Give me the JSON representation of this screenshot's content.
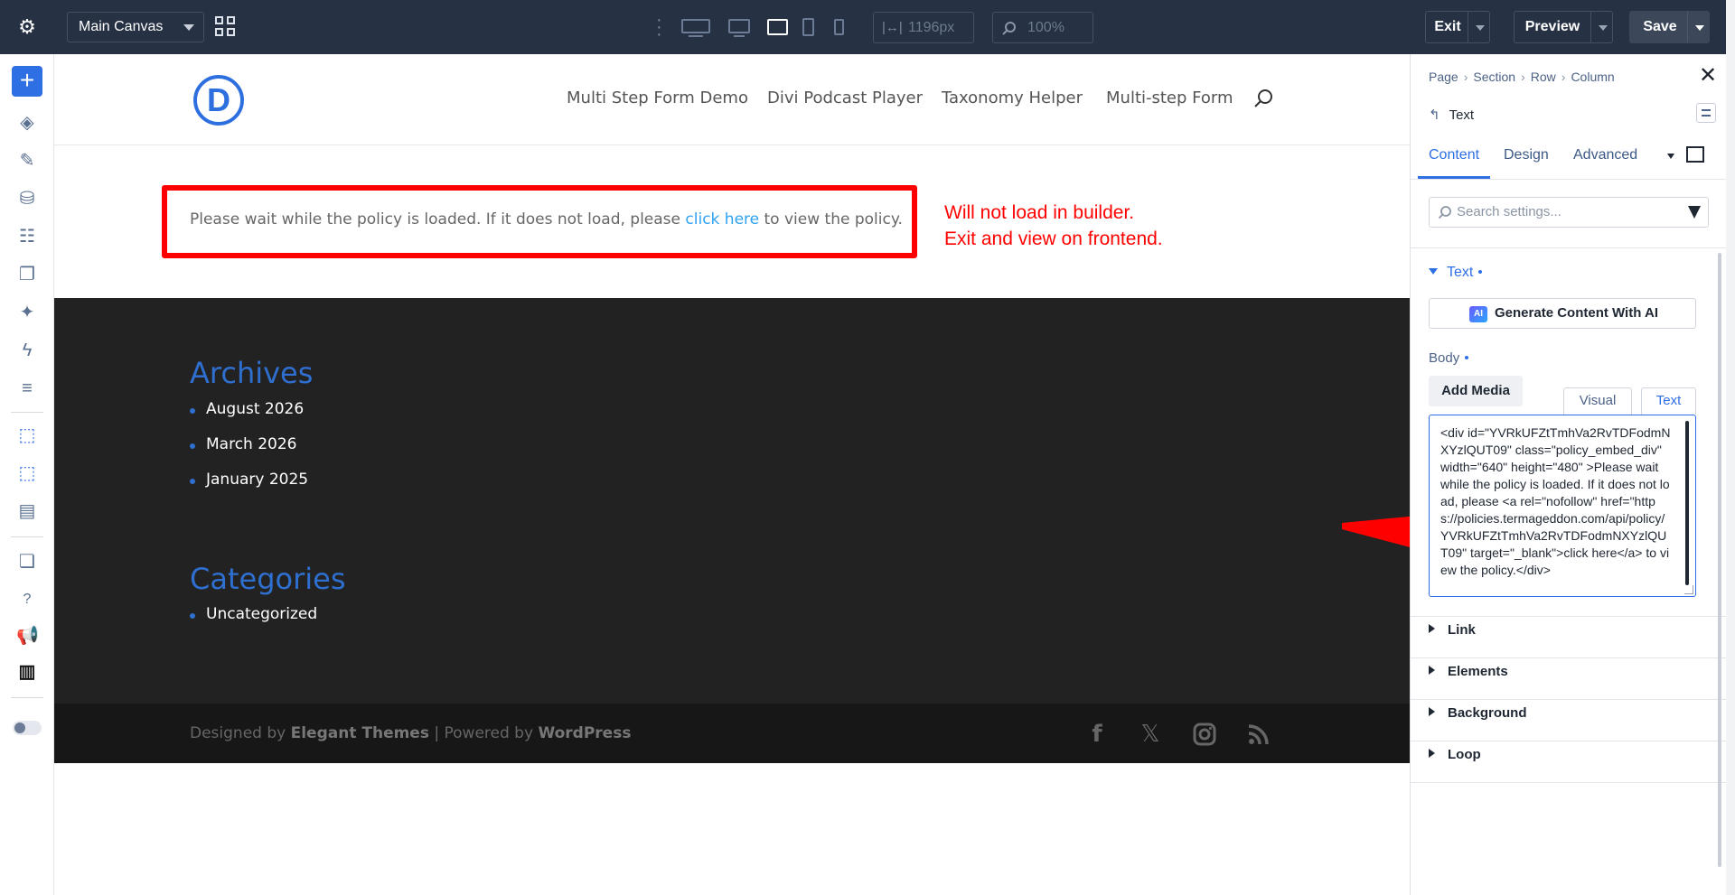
{
  "topbar": {
    "canvas_select": "Main Canvas",
    "width_value": "1196px",
    "zoom_value": "100%",
    "exit_label": "Exit",
    "preview_label": "Preview",
    "save_label": "Save"
  },
  "site": {
    "logo_letter": "D",
    "nav": [
      "Multi Step Form Demo",
      "Divi Podcast Player",
      "Taxonomy Helper",
      "Multi-step Form"
    ],
    "notice_before": "Please wait while the policy is loaded. If it does not load, please ",
    "notice_link": "click here",
    "notice_after": " to view the policy.",
    "red_note_line1": "Will not load in builder.",
    "red_note_line2": "Exit and view on frontend.",
    "archives_title": "Archives",
    "archives": [
      "August 2026",
      "March 2026",
      "January 2025"
    ],
    "categories_title": "Categories",
    "categories": [
      "Uncategorized"
    ],
    "credit_prefix": "Designed by ",
    "credit_brand1": "Elegant Themes",
    "credit_mid": " | Powered by ",
    "credit_brand2": "WordPress"
  },
  "panel": {
    "breadcrumb": [
      "Page",
      "Section",
      "Row",
      "Column"
    ],
    "module_title": "Text",
    "tabs": [
      "Content",
      "Design",
      "Advanced"
    ],
    "search_placeholder": "Search settings...",
    "group_text": "Text",
    "ai_button": "Generate Content With AI",
    "ai_badge": "AI",
    "body_label": "Body",
    "add_media": "Add Media",
    "editor_tabs": [
      "Visual",
      "Text"
    ],
    "code": "<div id=\"YVRkUFZtTmhVa2RvTDFodmNXYzlQUT09\" class=\"policy_embed_div\" width=\"640\" height=\"480\" >Please wait while the policy is loaded. If it does not load, please <a rel=\"nofollow\" href=\"https://policies.termageddon.com/api/policy/YVRkUFZtTmhVa2RvTDFodmNXYzlQUT09\" target=\"_blank\">click here</a> to view the policy.</div>",
    "groups": [
      "Link",
      "Elements",
      "Background",
      "Loop"
    ]
  },
  "colors": {
    "accent": "#2f6fe4",
    "annotation_red": "#ff0000",
    "footer_bg": "#222222",
    "topbar_bg": "#263143"
  }
}
